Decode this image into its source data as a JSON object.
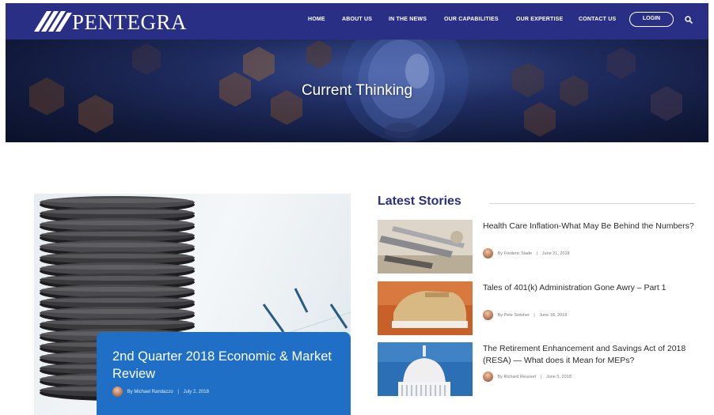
{
  "brand": {
    "name": "PENTEGRA",
    "nav_color": "#2a2f86",
    "accent_blue": "#1f6fc6"
  },
  "nav": {
    "items": [
      {
        "label": "HOME"
      },
      {
        "label": "ABOUT US"
      },
      {
        "label": "IN THE NEWS"
      },
      {
        "label": "OUR CAPABILITIES"
      },
      {
        "label": "OUR EXPERTISE"
      },
      {
        "label": "CONTACT US"
      }
    ],
    "login_label": "LOGIN",
    "search_icon": "search-icon"
  },
  "hero": {
    "title": "Current Thinking"
  },
  "featured": {
    "title": "2nd Quarter 2018 Economic & Market Review",
    "author": "By Michael Randazzo",
    "date": "July 2, 2018",
    "separator": "|"
  },
  "latest": {
    "heading": "Latest Stories",
    "stories": [
      {
        "title": "Health Care Inflation-What May Be Behind the Numbers?",
        "author": "By Frederic Slade",
        "date": "June 21, 2018"
      },
      {
        "title": "Tales of 401(k) Administration Gone Awry – Part 1",
        "author": "By Pete Swisher",
        "date": "June 18, 2018"
      },
      {
        "title": "The Retirement Enhancement and Savings Act of 2018 (RESA) — What does it Mean for MEPs?",
        "author": "By Richard Reusser",
        "date": "June 5, 2018"
      }
    ]
  }
}
